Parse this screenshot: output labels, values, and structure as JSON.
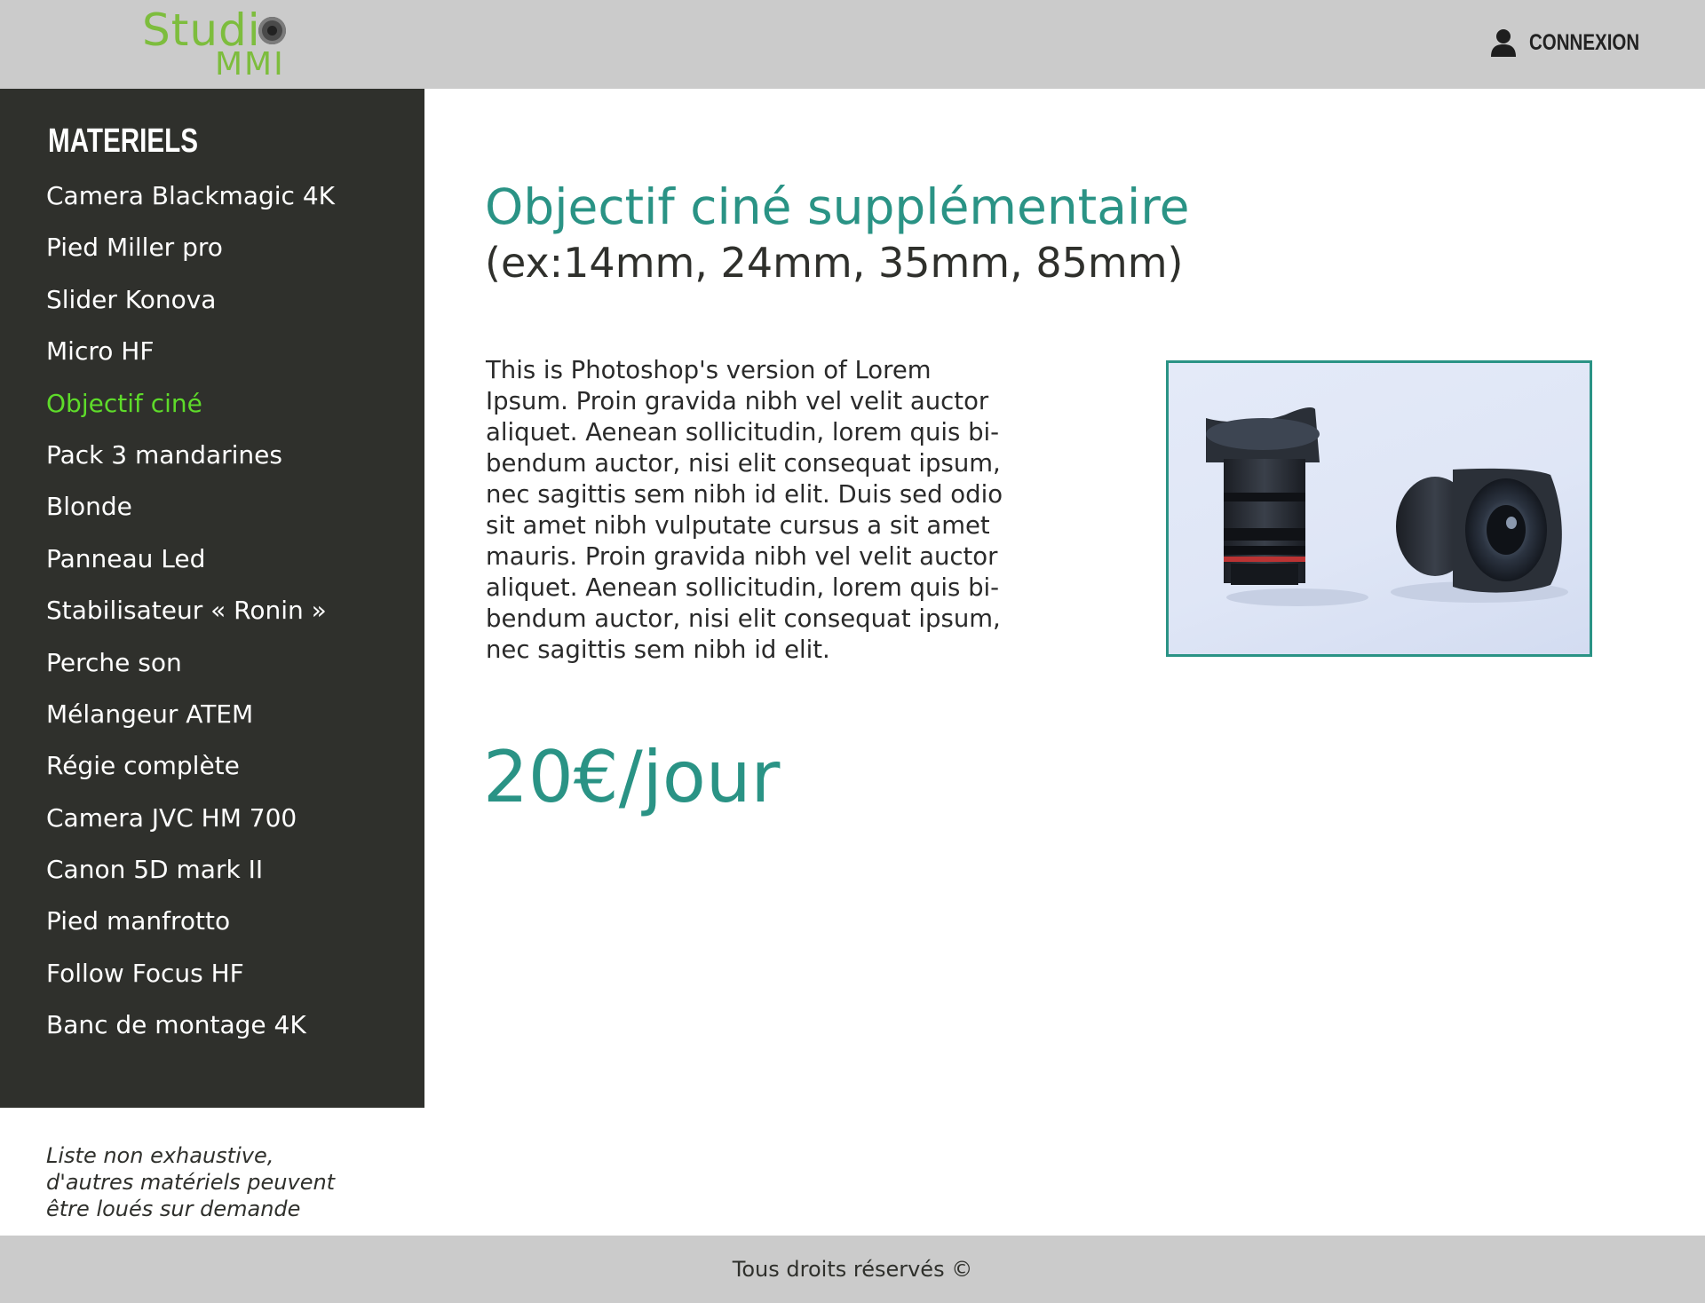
{
  "header": {
    "logo_studio": "Studi",
    "logo_mmi": "MMI",
    "login_label": "CONNEXION",
    "login_icon": "user-icon"
  },
  "sidebar": {
    "title": "MATERIELS",
    "items": [
      {
        "label": "Camera Blackmagic 4K"
      },
      {
        "label": "Pied Miller pro"
      },
      {
        "label": "Slider Konova"
      },
      {
        "label": "Micro HF"
      },
      {
        "label": "Objectif ciné"
      },
      {
        "label": "Pack 3 mandarines"
      },
      {
        "label": "Blonde"
      },
      {
        "label": "Panneau Led"
      },
      {
        "label": "Stabilisateur « Ronin »"
      },
      {
        "label": "Perche son"
      },
      {
        "label": "Mélangeur ATEM"
      },
      {
        "label": "Régie complète"
      },
      {
        "label": "Camera JVC HM 700"
      },
      {
        "label": "Canon 5D mark II"
      },
      {
        "label": "Pied manfrotto"
      },
      {
        "label": "Follow Focus HF"
      },
      {
        "label": "Banc de montage 4K"
      }
    ],
    "active_index": 4,
    "note_lines": [
      "Liste non exhaustive,",
      "d'autres matériels peuvent",
      "être loués sur demande"
    ]
  },
  "product": {
    "title": "Objectif ciné supplémentaire",
    "subtitle": "(ex:14mm, 24mm, 35mm, 85mm)",
    "description_lines": [
      "This is Photoshop's version  of Lorem",
      "Ipsum. Proin gravida nibh vel velit auctor",
      "aliquet. Aenean sollicitudin, lorem quis bi-",
      "bendum auctor, nisi elit consequat ipsum,",
      "nec sagittis sem nibh id elit. Duis sed odio",
      "sit amet nibh vulputate cursus a sit amet",
      "mauris. Proin gravida nibh vel velit auctor",
      "aliquet. Aenean sollicitudin, lorem quis bi-",
      "bendum auctor, nisi elit consequat ipsum,",
      "nec sagittis sem nibh id elit."
    ],
    "price": "20€/jour",
    "image_subject": "two cine lenses on white background"
  },
  "footer": {
    "copyright": "Tous droits réservés ©"
  },
  "colors": {
    "accent": "#2a9385",
    "active_menu": "#5edb2a",
    "logo_green": "#7dbd3d",
    "sidebar_bg": "#2f302c",
    "header_bg": "#cbcbcb"
  }
}
